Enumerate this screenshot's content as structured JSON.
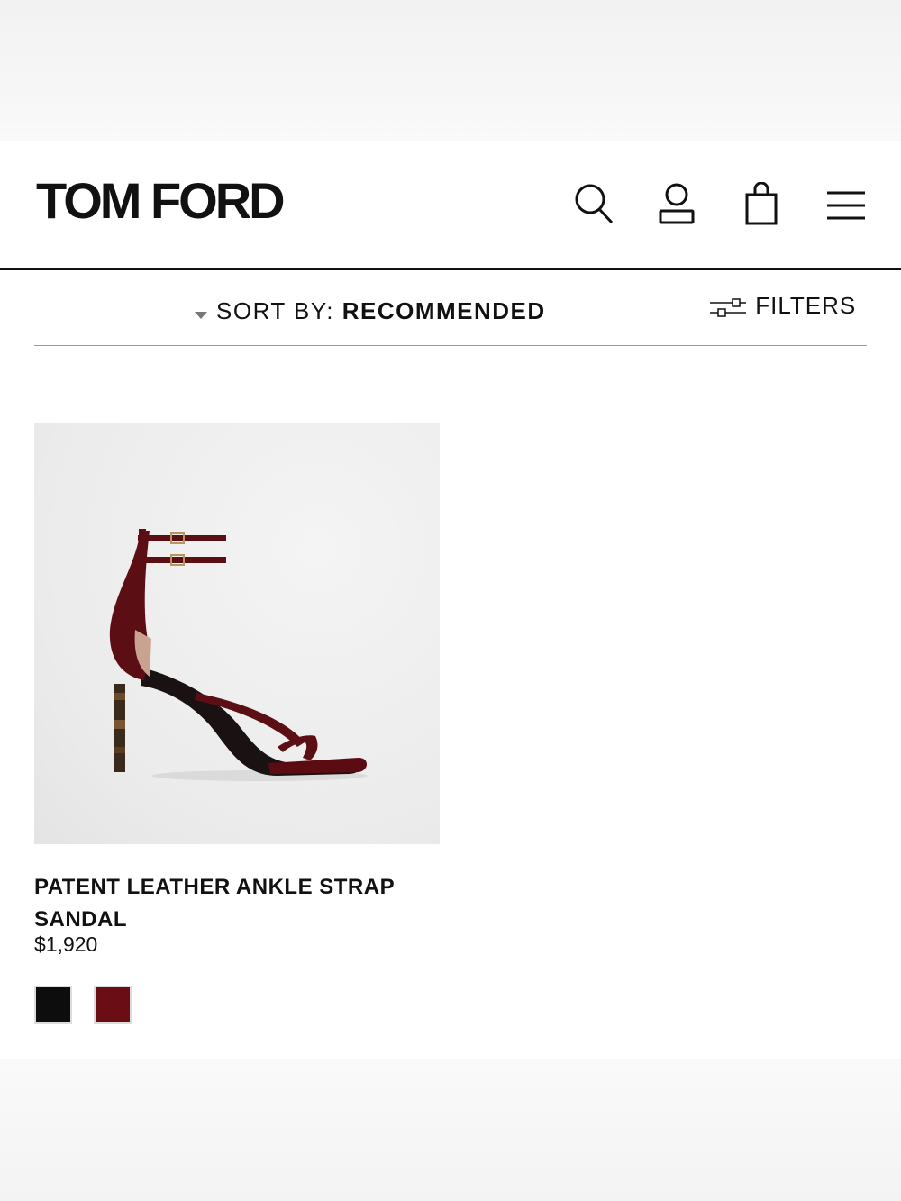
{
  "brand": {
    "logo_text": "TOM FORD"
  },
  "header": {
    "icons": [
      "search-icon",
      "account-icon",
      "shopping-bag-icon",
      "menu-icon"
    ]
  },
  "toolbar": {
    "sort_label": "SORT BY:",
    "sort_value": "RECOMMENDED",
    "filters_label": "FILTERS"
  },
  "products": [
    {
      "title": "PATENT LEATHER ANKLE STRAP SANDAL",
      "price": "$1,920",
      "swatches": [
        {
          "name": "black",
          "color": "#0d0d0d"
        },
        {
          "name": "burgundy",
          "color": "#6a0d14"
        }
      ]
    }
  ],
  "colors": {
    "text": "#111111",
    "divider": "#9a9a9a",
    "swatch_border": "#dcdcdc"
  }
}
